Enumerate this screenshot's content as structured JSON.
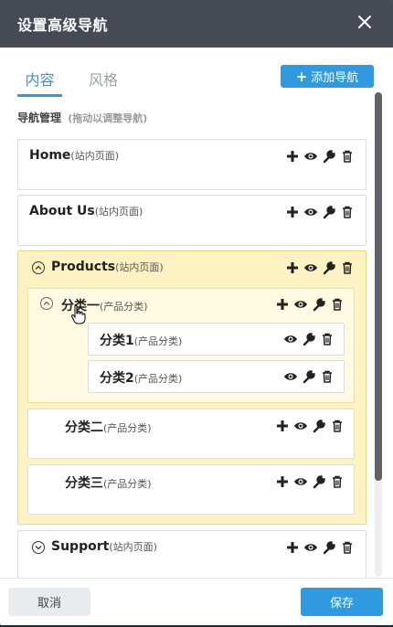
{
  "dialog": {
    "title": "设置高级导航",
    "close_icon": "close-icon"
  },
  "tabs": [
    {
      "label": "内容",
      "active": true
    },
    {
      "label": "风格",
      "active": false
    }
  ],
  "add_nav": {
    "plus": "+",
    "label": "添加导航"
  },
  "section": {
    "title": "导航管理",
    "hint": "(拖动以调整导航)"
  },
  "items": {
    "home": {
      "name": "Home",
      "type": "(站内页面)"
    },
    "about": {
      "name": "About Us",
      "type": "(站内页面)"
    },
    "products": {
      "name": "Products",
      "type": "(站内页面)"
    },
    "cat1": {
      "name": "分类一",
      "type": "(产品分类)"
    },
    "cat1_1": {
      "name": "分类1",
      "type": "(产品分类)"
    },
    "cat1_2": {
      "name": "分类2",
      "type": "(产品分类)"
    },
    "cat2": {
      "name": "分类二",
      "type": "(产品分类)"
    },
    "cat3": {
      "name": "分类三",
      "type": "(产品分类)"
    },
    "support": {
      "name": "Support",
      "type": "(站内页面)"
    }
  },
  "footer": {
    "cancel": "取消",
    "save": "保存"
  },
  "colors": {
    "accent": "#2f9ae0",
    "title_bg": "#454a54",
    "expanded_bg": "#fdf2c1"
  }
}
